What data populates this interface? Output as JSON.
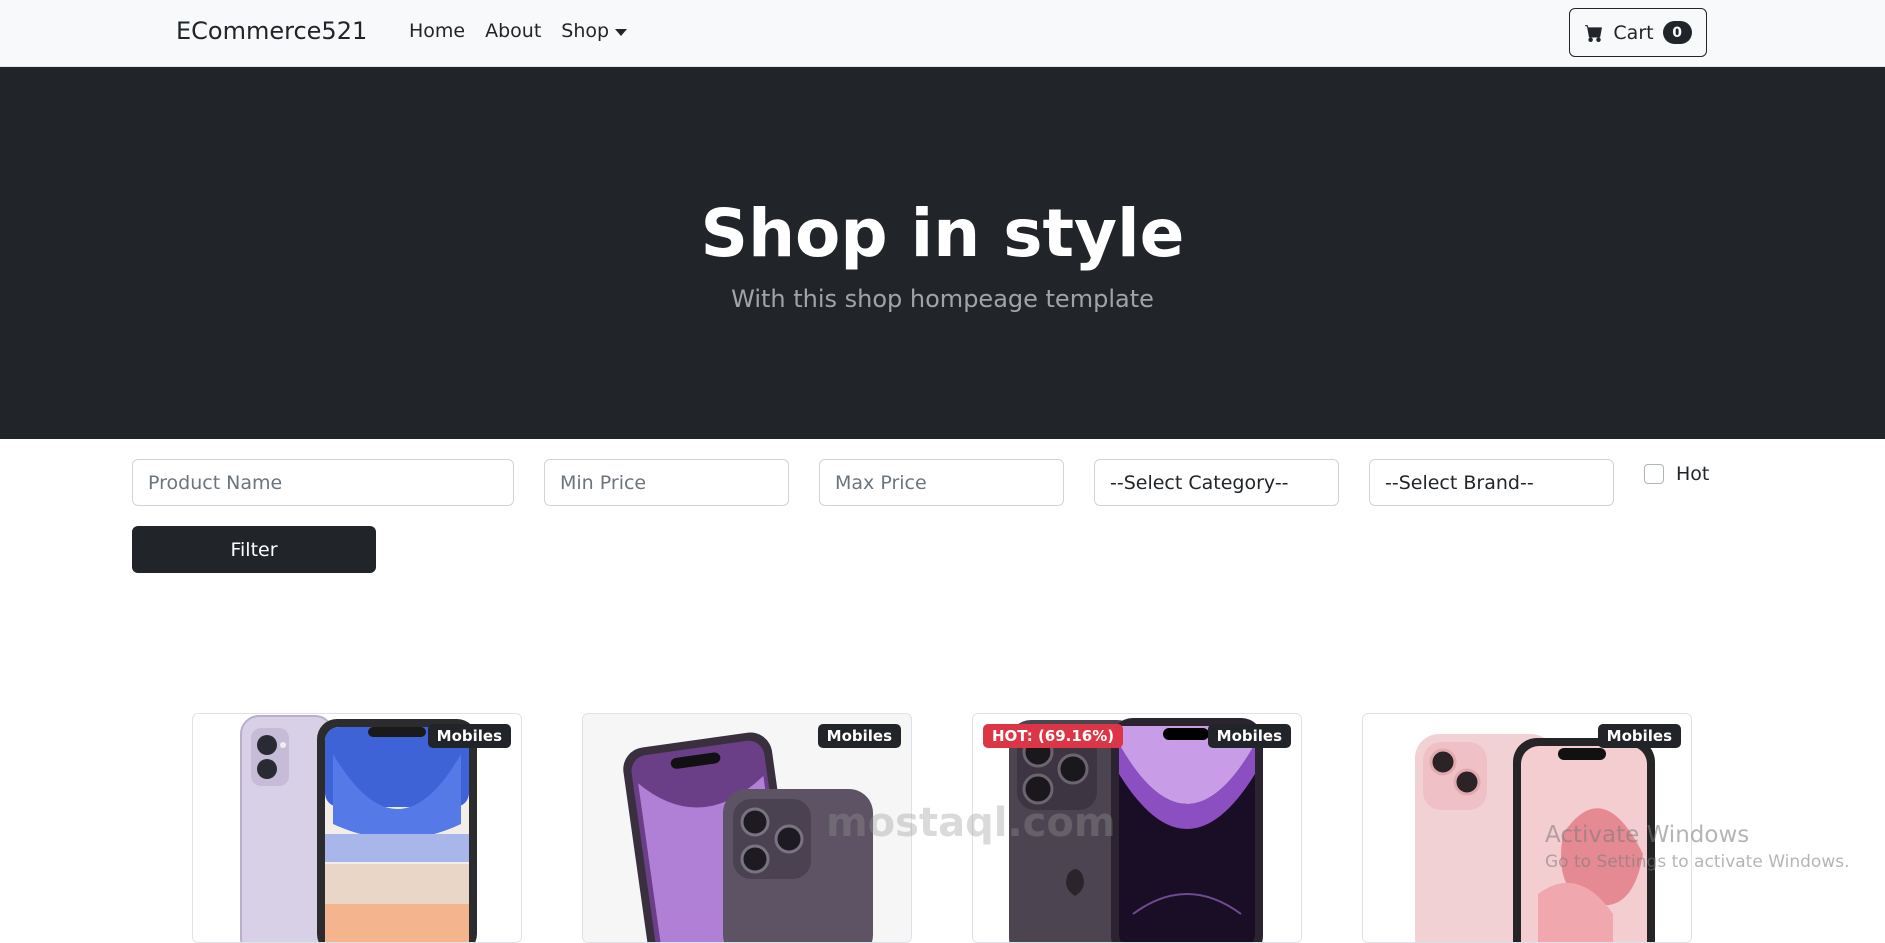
{
  "navbar": {
    "brand": "ECommerce521",
    "links": [
      "Home",
      "About",
      "Shop"
    ],
    "cart_label": "Cart",
    "cart_count": "0"
  },
  "hero": {
    "title": "Shop in style",
    "subtitle": "With this shop hompeage template"
  },
  "filters": {
    "product_name_placeholder": "Product Name",
    "min_price_placeholder": "Min Price",
    "max_price_placeholder": "Max Price",
    "category_selected": "--Select Category--",
    "brand_selected": "--Select Brand--",
    "hot_label": "Hot",
    "filter_button": "Filter"
  },
  "products": [
    {
      "category": "Mobiles",
      "hot": ""
    },
    {
      "category": "Mobiles",
      "hot": ""
    },
    {
      "category": "Mobiles",
      "hot": "HOT: (69.16%)"
    },
    {
      "category": "Mobiles",
      "hot": ""
    }
  ],
  "watermark": "mostaql.com",
  "activate_windows": {
    "title": "Activate Windows",
    "subtitle": "Go to Settings to activate Windows."
  },
  "colors": {
    "dark": "#212529",
    "hot": "#dc3545",
    "navbar_bg": "#f8f9fa"
  }
}
